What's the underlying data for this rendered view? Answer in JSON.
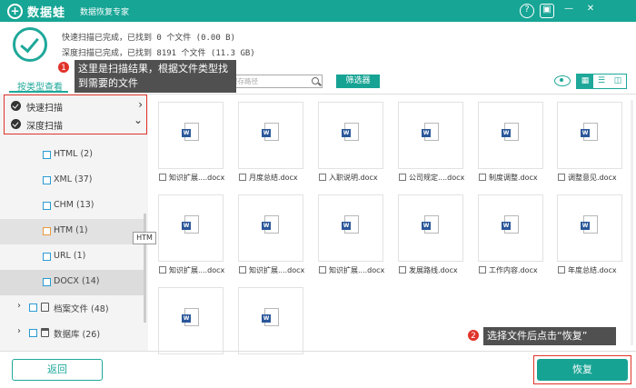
{
  "app": {
    "logo": "+",
    "name": "数据蛙",
    "subtitle": "数据恢复专家"
  },
  "window_controls": [
    "?",
    "▣",
    "—",
    "✕"
  ],
  "status": {
    "quick_scan": "快速扫描已完成，已找到 0 个文件 (0.00  B)",
    "deep_scan": "深度扫描已完成，已找到 8191 个文件 (11.3 GB)"
  },
  "tab": {
    "label": "按类型查看"
  },
  "search": {
    "placeholder": "在当前输入文件名称来保存路径"
  },
  "filter_label": "筛选器",
  "scan_groups": [
    {
      "label": "快速扫描",
      "arrow": "›"
    },
    {
      "label": "深度扫描",
      "arrow": "⌄"
    }
  ],
  "tree": [
    {
      "label": "HTML (2)"
    },
    {
      "label": "XML (37)"
    },
    {
      "label": "CHM (13)"
    },
    {
      "label": "HTM (1)"
    },
    {
      "label": "URL (1)"
    },
    {
      "label": "DOCX (14)"
    }
  ],
  "tree_parents": [
    {
      "label": "档案文件 (48)"
    },
    {
      "label": "数据库 (26)"
    }
  ],
  "tooltip": "HTM",
  "files": [
    {
      "name": "知识扩展....docx"
    },
    {
      "name": "月度总结.docx"
    },
    {
      "name": "入职说明.docx"
    },
    {
      "name": "公司规定....docx"
    },
    {
      "name": "制度调整.docx"
    },
    {
      "name": "调整意见.docx"
    },
    {
      "name": "知识扩展....docx"
    },
    {
      "name": "知识扩展....docx"
    },
    {
      "name": "知识扩展....docx"
    },
    {
      "name": "发展路线.docx"
    },
    {
      "name": "工作内容.docx"
    },
    {
      "name": "年度总结.docx"
    },
    {
      "name": ""
    },
    {
      "name": ""
    }
  ],
  "callouts": {
    "one": {
      "badge": "1",
      "text": "这里是扫描结果，根据文件类型找到需要的文件"
    },
    "two": {
      "badge": "2",
      "text": "选择文件后点击“恢复”"
    }
  },
  "buttons": {
    "back": "返回",
    "recover": "恢复"
  },
  "colors": {
    "accent": "#16a394",
    "highlight": "#e0342a",
    "callout_bg": "#505050"
  }
}
